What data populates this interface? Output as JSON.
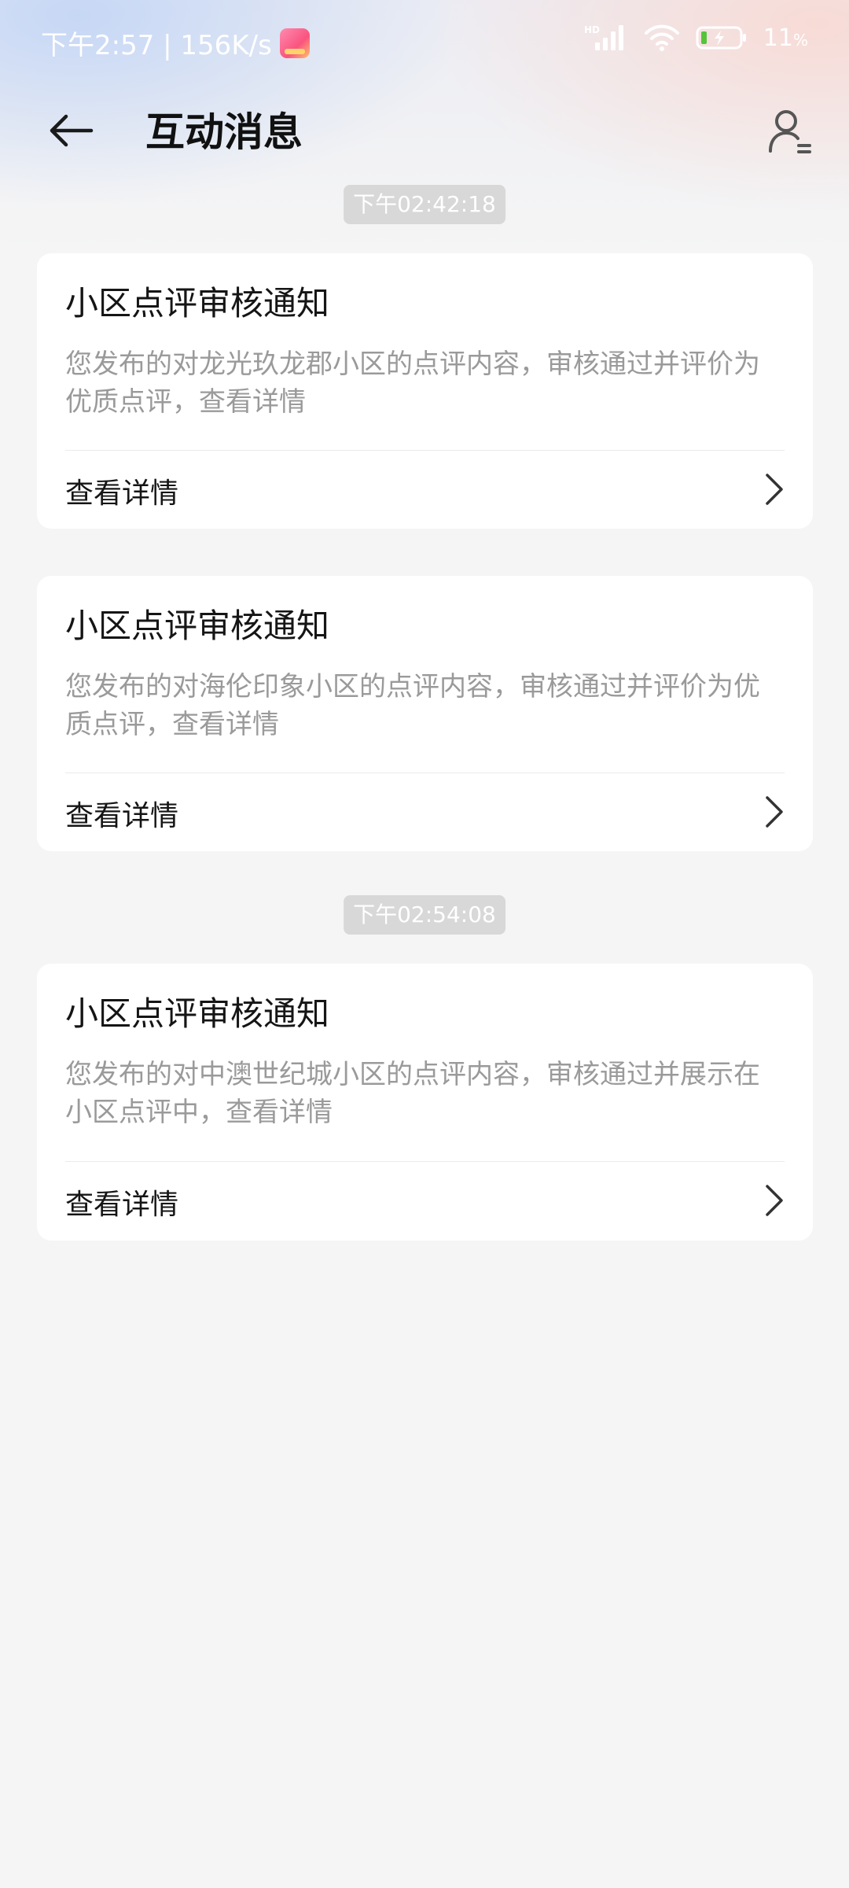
{
  "status_bar": {
    "time": "下午2:57 | 156K/s",
    "app_badge": "bilibili-icon",
    "network_label": "HD",
    "battery": "11",
    "battery_unit": "%"
  },
  "header": {
    "title": "互动消息",
    "back_icon": "back-arrow-icon",
    "profile_icon": "user-list-icon"
  },
  "groups": [
    {
      "time": "下午02:42:18",
      "cards": [
        {
          "title": "小区点评审核通知",
          "body": "您发布的对龙光玖龙郡小区的点评内容，审核通过并评价为优质点评，查看详情",
          "action": "查看详情"
        },
        {
          "title": "小区点评审核通知",
          "body": "您发布的对海伦印象小区的点评内容，审核通过并评价为优质点评，查看详情",
          "action": "查看详情"
        }
      ]
    },
    {
      "time": "下午02:54:08",
      "cards": [
        {
          "title": "小区点评审核通知",
          "body": "您发布的对中澳世纪城小区的点评内容，审核通过并展示在小区点评中，查看详情",
          "action": "查看详情"
        }
      ]
    }
  ],
  "colors": {
    "background": "#f5f5f5",
    "card": "#ffffff",
    "title_text": "#151515",
    "body_text": "#9a9a9a",
    "time_chip": "#d8d8d8"
  }
}
